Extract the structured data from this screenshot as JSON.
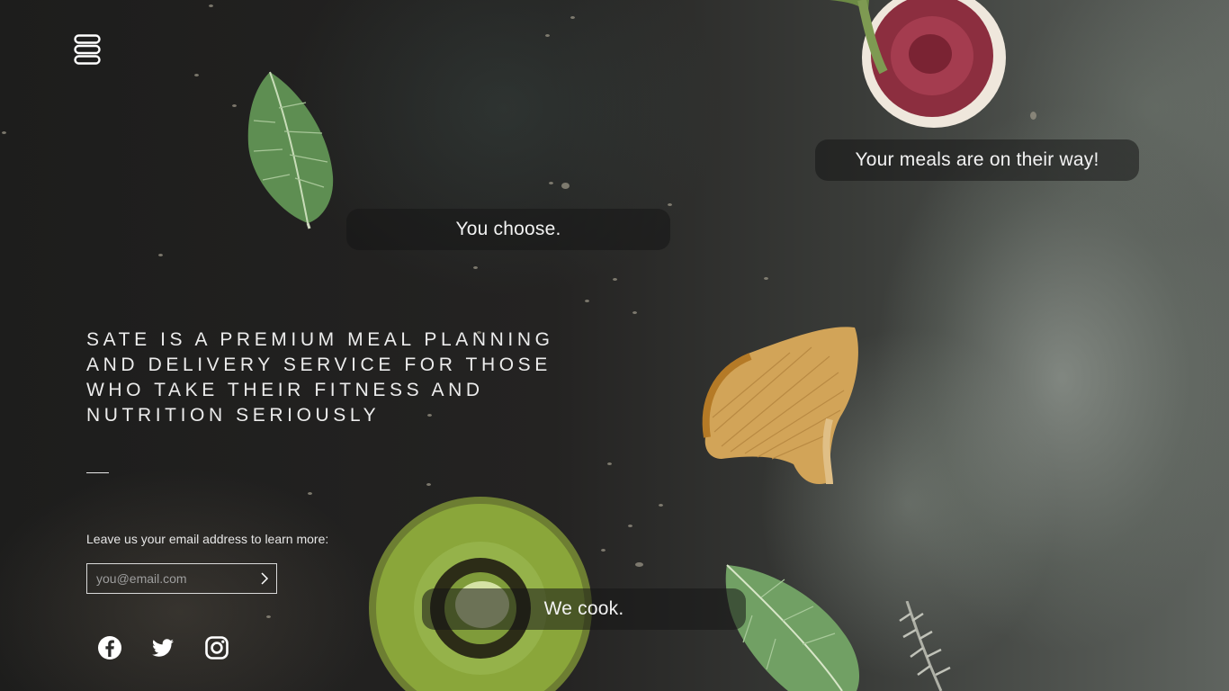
{
  "brand": {
    "logo_icon": "sate-logo-icon"
  },
  "steps": {
    "choose": "You choose.",
    "on_the_way": "Your meals are on their way!",
    "cook": "We cook."
  },
  "intro": {
    "headline": "SATE IS A PREMIUM MEAL PLANNING AND DELIVERY SERVICE FOR THOSE WHO TAKE THEIR FITNESS AND NUTRITION SERIOUSLY"
  },
  "signup": {
    "label": "Leave us your email address to learn more:",
    "placeholder": "you@email.com",
    "value": "",
    "submit_icon": "chevron-right-icon"
  },
  "social": [
    {
      "name": "facebook",
      "icon": "facebook-icon"
    },
    {
      "name": "twitter",
      "icon": "twitter-icon"
    },
    {
      "name": "instagram",
      "icon": "instagram-icon"
    }
  ],
  "decorations": [
    "mint-leaf",
    "fig-half",
    "chanterelle-mushroom",
    "kiwi-slice",
    "mint-leaf"
  ],
  "colors": {
    "text": "#ffffff",
    "pill_background": "rgba(22,22,22,0.55)",
    "input_border": "#d9d9d9",
    "placeholder": "#9e9e9e"
  }
}
